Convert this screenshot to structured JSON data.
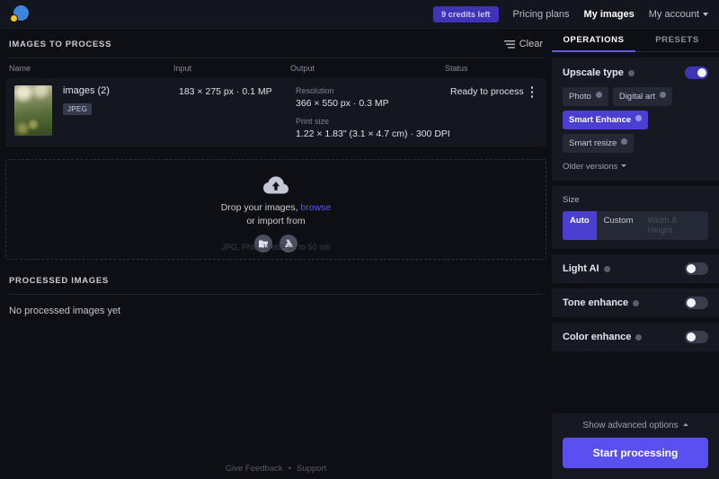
{
  "topbar": {
    "logo_name": "ai-image-enlarger-logo",
    "credits_badge": "9 credits left",
    "links": [
      {
        "label": "Pricing plans",
        "active": false
      },
      {
        "label": "My images",
        "active": true
      },
      {
        "label": "My account",
        "active": false
      }
    ]
  },
  "left": {
    "images_section_title": "IMAGES TO PROCESS",
    "clear_label": "Clear",
    "clear_icon": "list-lines-icon",
    "columns": {
      "name": "Name",
      "input": "Input",
      "output": "Output",
      "status": "Status"
    },
    "rows": [
      {
        "thumbnail": "blurred-nature-photo-thumbnail",
        "filename": "images (2)",
        "format_badge": "JPEG",
        "input": "183 × 275 px · 0.1 MP",
        "output_resolution_label": "Resolution",
        "output_resolution": "366 × 550 px · 0.3 MP",
        "output_printsize_label": "Print size",
        "output_printsize": "1.22 × 1.83\" (3.1 × 4.7 cm) · 300 DPI",
        "status": "Ready to process",
        "menu_icon": "kebab-menu-icon"
      }
    ],
    "dropzone": {
      "icon": "cloud-upload-icon",
      "text_prefix": "Drop your images, ",
      "browse_link": "browse",
      "text_second_line": "or import from",
      "import_icons": [
        "dropbox-folder-icon",
        "google-drive-icon"
      ],
      "note": "JPG, PNG, WebP up to 50 mb"
    },
    "processed_section_title": "PROCESSED IMAGES",
    "processed_empty": "No processed images yet",
    "footer": {
      "feedback": "Give Feedback",
      "separator": "•",
      "support": "Support"
    }
  },
  "right": {
    "tabs": [
      {
        "label": "OPERATIONS",
        "active": true
      },
      {
        "label": "PRESETS",
        "active": false
      }
    ],
    "upscale": {
      "title": "Upscale type",
      "enabled": true,
      "options": [
        {
          "label": "Photo",
          "selected": false
        },
        {
          "label": "Digital art",
          "selected": false
        },
        {
          "label": "Smart Enhance",
          "selected": true
        },
        {
          "label": "Smart resize",
          "selected": false
        }
      ],
      "older_versions": "Older versions"
    },
    "size": {
      "label": "Size",
      "options": [
        {
          "label": "Auto",
          "selected": true,
          "disabled": false
        },
        {
          "label": "Custom",
          "selected": false,
          "disabled": false
        },
        {
          "label": "Width & Height",
          "selected": false,
          "disabled": true
        }
      ]
    },
    "toggles": [
      {
        "label": "Light AI",
        "on": false
      },
      {
        "label": "Tone enhance",
        "on": false
      },
      {
        "label": "Color enhance",
        "on": false
      }
    ],
    "advanced_label": "Show advanced options",
    "start_label": "Start processing"
  },
  "colors": {
    "accent": "#5a4ff0",
    "accent_pill": "#4b3fd1",
    "badge_purple": "#3f34b5",
    "link_blue": "#5a5ce8",
    "bg": "#0d0f14",
    "panel": "#161921"
  }
}
